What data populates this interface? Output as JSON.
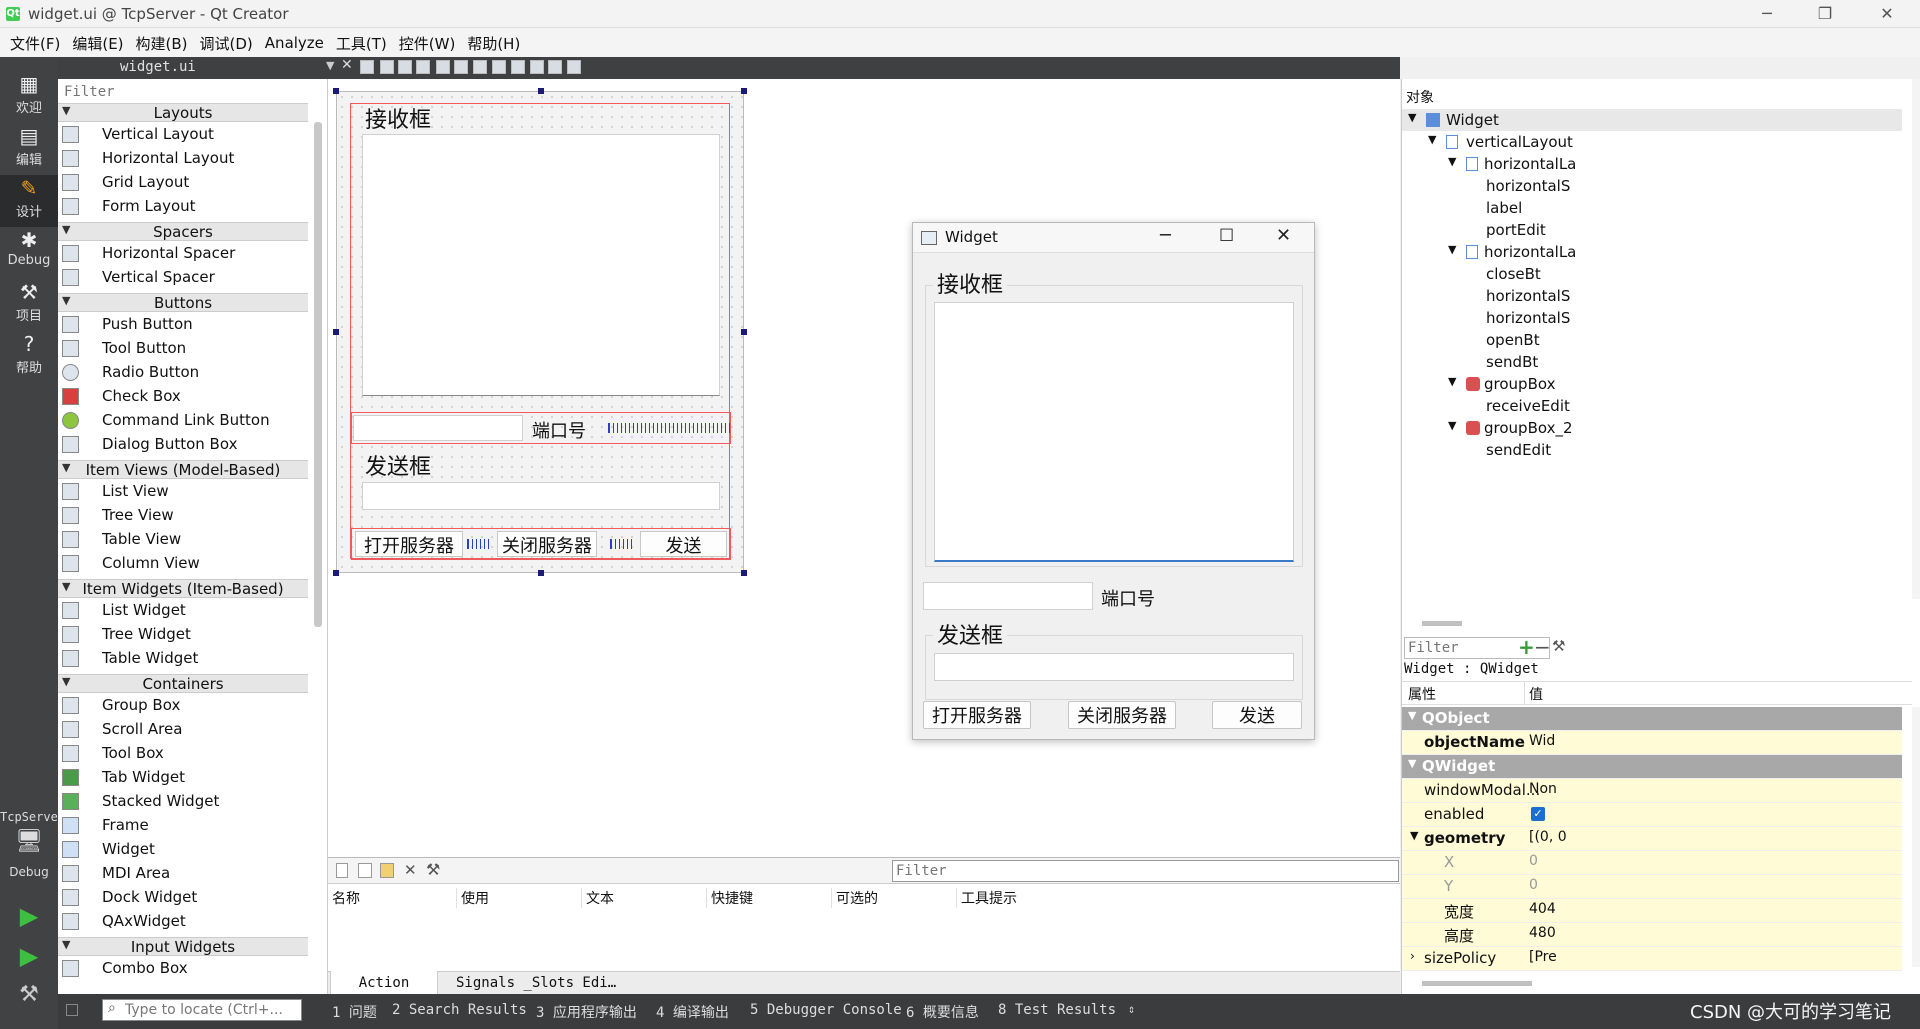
{
  "window": {
    "title": "widget.ui @ TcpServer - Qt Creator",
    "app_icon": "Qt"
  },
  "menu": [
    "文件(F)",
    "编辑(E)",
    "构建(B)",
    "调试(D)",
    "Analyze",
    "工具(T)",
    "控件(W)",
    "帮助(H)"
  ],
  "modes": [
    {
      "label": "欢迎",
      "icon": "grid-icon"
    },
    {
      "label": "编辑",
      "icon": "edit-icon"
    },
    {
      "label": "设计",
      "icon": "pencil-icon"
    },
    {
      "label": "Debug",
      "icon": "bug-icon"
    },
    {
      "label": "项目",
      "icon": "wrench-icon"
    },
    {
      "label": "帮助",
      "icon": "help-icon"
    }
  ],
  "kit": {
    "project": "TcpServer",
    "config": "Debug"
  },
  "doc": {
    "filename": "widget.ui"
  },
  "widgetbox": {
    "filter_placeholder": "Filter",
    "layouts_title": "Layouts",
    "layouts": [
      "Vertical Layout",
      "Horizontal Layout",
      "Grid Layout",
      "Form Layout"
    ],
    "spacers_title": "Spacers",
    "spacers": [
      "Horizontal Spacer",
      "Vertical Spacer"
    ],
    "buttons_title": "Buttons",
    "buttons": [
      "Push Button",
      "Tool Button",
      "Radio Button",
      "Check Box",
      "Command Link Button",
      "Dialog Button Box"
    ],
    "itemviews_title": "Item Views (Model-Based)",
    "itemviews": [
      "List View",
      "Tree View",
      "Table View",
      "Column View"
    ],
    "itemwidgets_title": "Item Widgets (Item-Based)",
    "itemwidgets": [
      "List Widget",
      "Tree Widget",
      "Table Widget"
    ],
    "containers_title": "Containers",
    "containers": [
      "Group Box",
      "Scroll Area",
      "Tool Box",
      "Tab Widget",
      "Stacked Widget",
      "Frame",
      "Widget",
      "MDI Area",
      "Dock Widget",
      "QAxWidget"
    ],
    "inputs_title": "Input Widgets",
    "inputs": [
      "Combo Box"
    ]
  },
  "form": {
    "receive_title": "接收框",
    "port_label": "端口号",
    "send_title": "发送框",
    "open_btn": "打开服务器",
    "close_btn": "关闭服务器",
    "send_btn": "发送"
  },
  "preview": {
    "title": "Widget",
    "receive_title": "接收框",
    "port_label": "端口号",
    "send_title": "发送框",
    "open_btn": "打开服务器",
    "close_btn": "关闭服务器",
    "send_btn": "发送"
  },
  "objects": {
    "header": "对象",
    "rows": [
      "Widget",
      "verticalLayout",
      "horizontalLa",
      "horizontalS",
      "label",
      "portEdit",
      "horizontalLa",
      "closeBt",
      "horizontalS",
      "horizontalS",
      "openBt",
      "sendBt",
      "groupBox",
      "receiveEdit",
      "groupBox_2",
      "sendEdit"
    ]
  },
  "props": {
    "filter_placeholder": "Filter",
    "class_line": "Widget : QWidget",
    "col_name": "属性",
    "col_value": "值",
    "rows": [
      {
        "k": "QObject",
        "v": ""
      },
      {
        "k": "objectName",
        "v": "Wid"
      },
      {
        "k": "QWidget",
        "v": ""
      },
      {
        "k": "windowModal...",
        "v": "Non"
      },
      {
        "k": "enabled",
        "v": ""
      },
      {
        "k": "geometry",
        "v": "[(0, 0"
      },
      {
        "k": "X",
        "v": "0"
      },
      {
        "k": "Y",
        "v": "0"
      },
      {
        "k": "宽度",
        "v": "404"
      },
      {
        "k": "高度",
        "v": "480"
      },
      {
        "k": "sizePolicy",
        "v": "[Pre"
      }
    ]
  },
  "actions": {
    "filter_placeholder": "Filter",
    "columns": [
      "名称",
      "使用",
      "文本",
      "快捷键",
      "可选的",
      "工具提示"
    ],
    "tabs": [
      "Action Editor",
      "Signals _Slots Edi…"
    ]
  },
  "status": {
    "locate_placeholder": "Type to locate (Ctrl+...",
    "items": [
      "1 问题",
      "2 Search Results",
      "3 应用程序输出",
      "4 编译输出",
      "5 Debugger Console",
      "6 概要信息",
      "8 Test Results"
    ],
    "watermark": "CSDN @大可的学习笔记"
  }
}
